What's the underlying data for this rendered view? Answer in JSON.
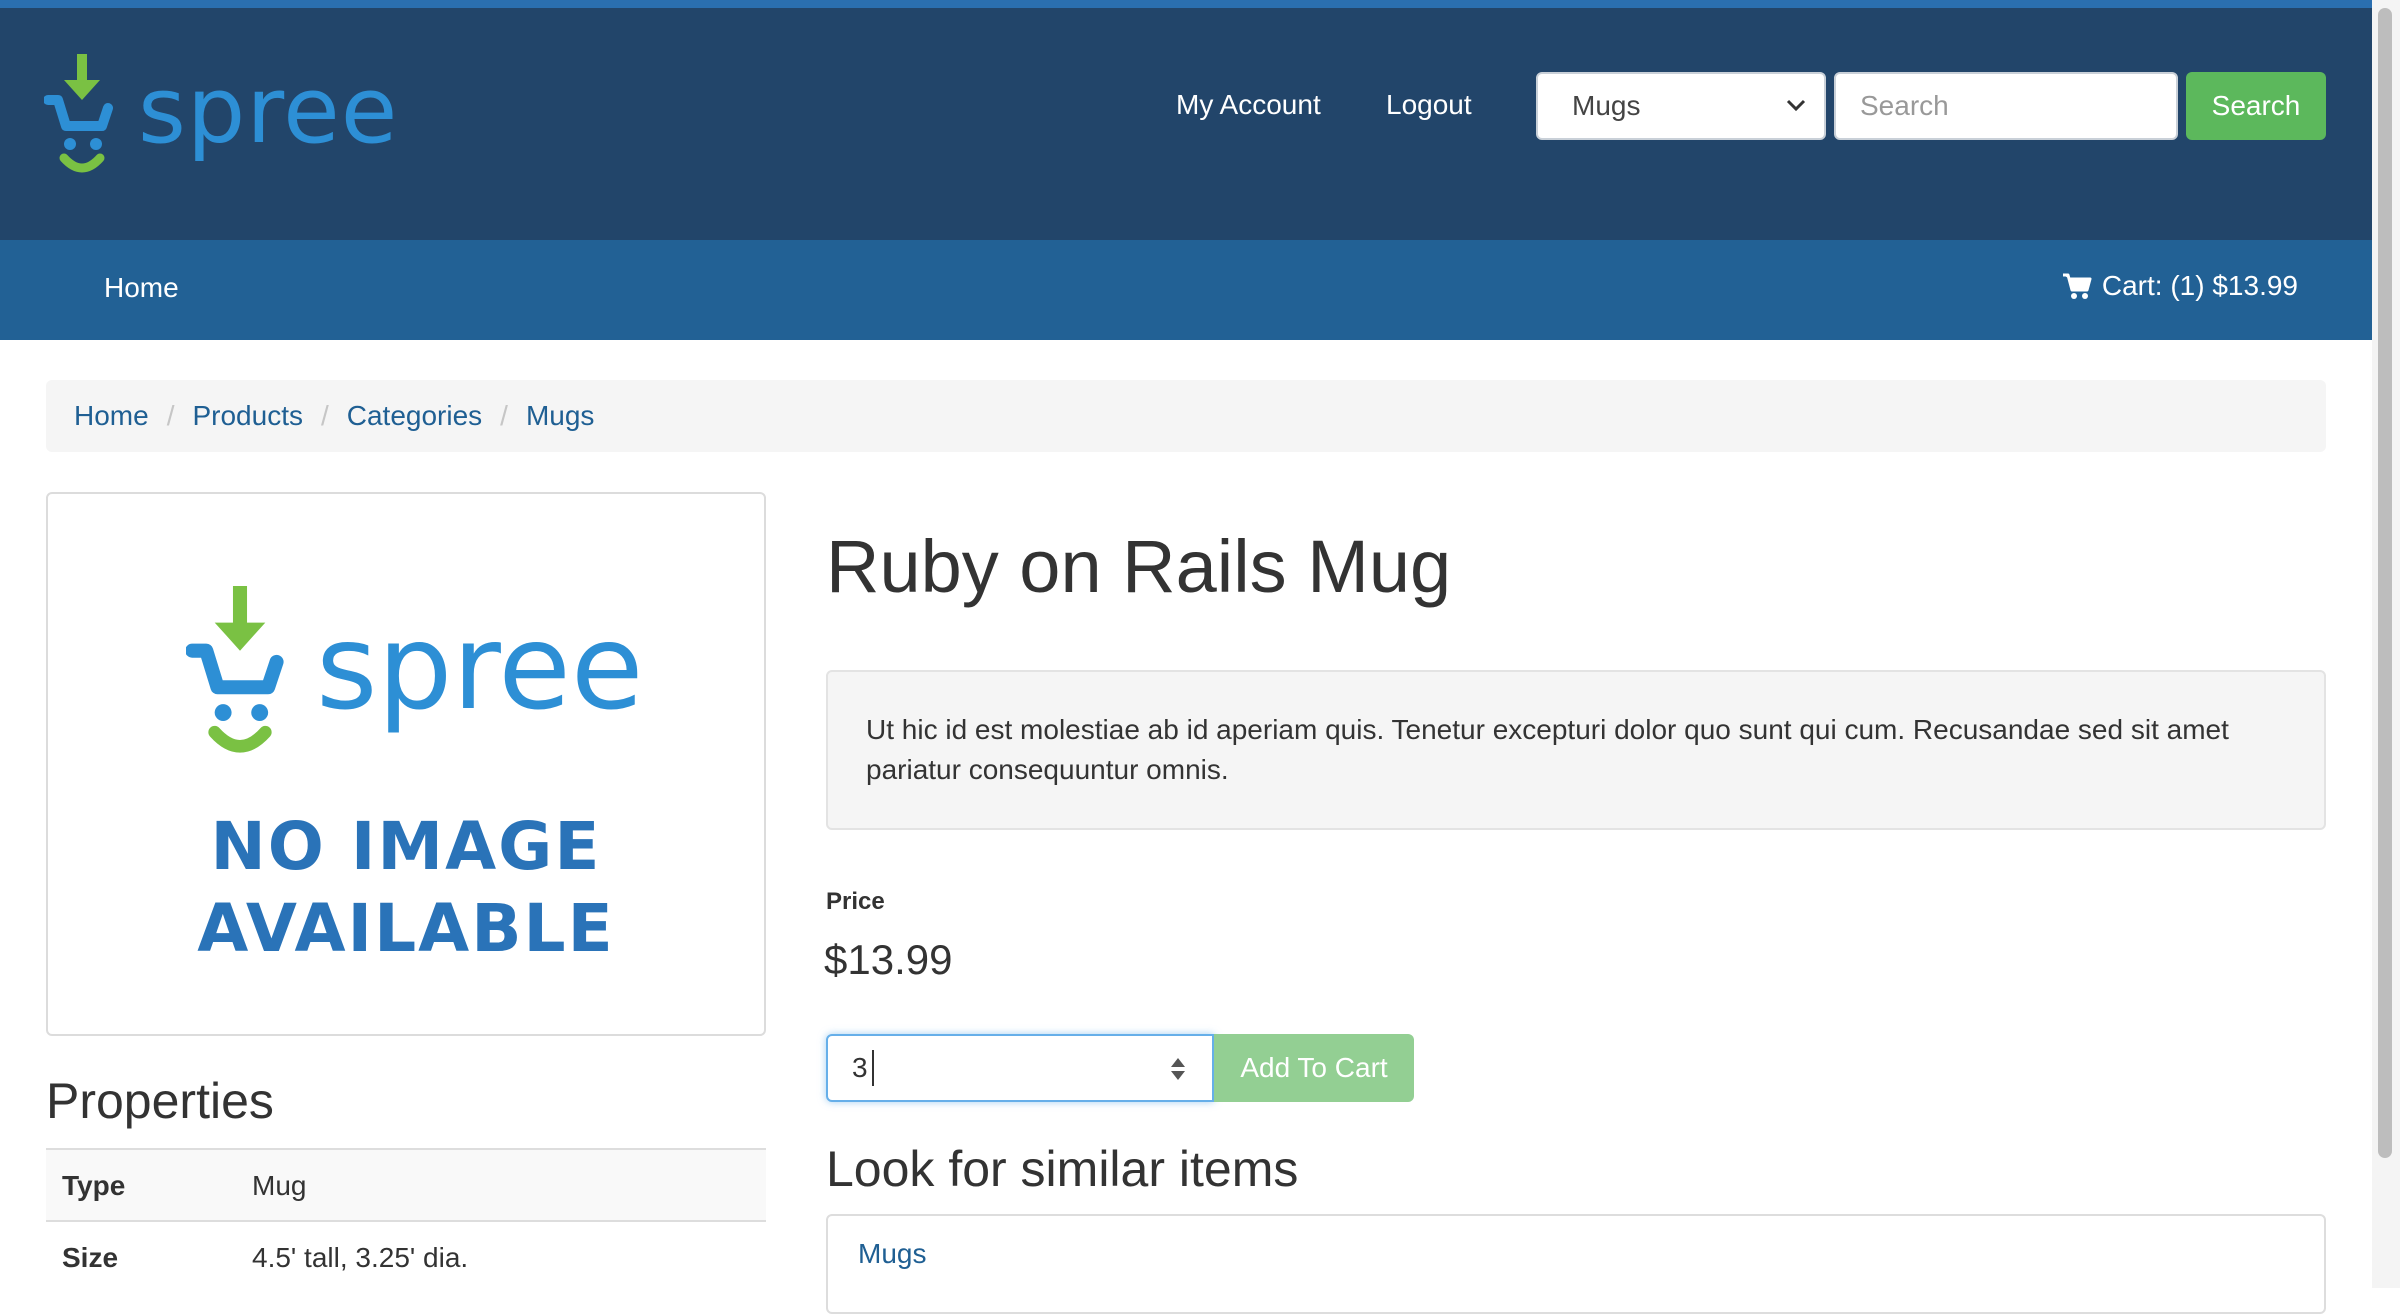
{
  "header": {
    "logo_text": "spree",
    "links": {
      "account": "My Account",
      "logout": "Logout"
    },
    "taxon_select": {
      "selected": "Mugs"
    },
    "search": {
      "placeholder": "Search",
      "button": "Search"
    }
  },
  "nav": {
    "home": "Home",
    "cart": "Cart: (1) $13.99"
  },
  "breadcrumb": {
    "items": [
      "Home",
      "Products",
      "Categories",
      "Mugs"
    ],
    "separator": "/"
  },
  "product": {
    "no_image": {
      "logo_text": "spree",
      "line1": "NO IMAGE",
      "line2": "AVAILABLE"
    },
    "title": "Ruby on Rails Mug",
    "description": "Ut hic id est molestiae ab id aperiam quis. Tenetur excepturi dolor quo sunt qui cum. Recusandae sed sit amet pariatur consequuntur omnis.",
    "price_label": "Price",
    "price": "$13.99",
    "quantity": "3",
    "add_to_cart": "Add To Cart"
  },
  "properties": {
    "heading": "Properties",
    "rows": [
      {
        "key": "Type",
        "value": "Mug"
      },
      {
        "key": "Size",
        "value": "4.5' tall, 3.25' dia."
      }
    ]
  },
  "similar": {
    "heading": "Look for similar items",
    "items": [
      "Mugs"
    ]
  },
  "colors": {
    "header_bg": "#22456a",
    "nav_bg": "#226195",
    "brand_blue": "#2d8fd5",
    "brand_green": "#7ac143",
    "success": "#5cb85c",
    "link": "#1f5f93"
  },
  "icons": [
    "spree-logo-icon",
    "chevron-down-icon",
    "cart-icon",
    "spinner-arrows-icon"
  ]
}
